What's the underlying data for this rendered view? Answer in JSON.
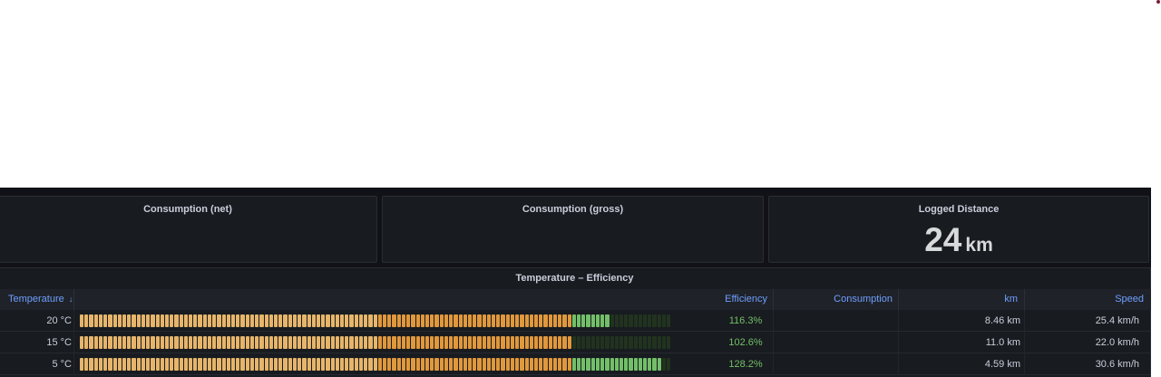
{
  "colors": {
    "panel_bg": "#181b1f",
    "header_text": "#6e9fff",
    "efficiency_text": "#73bf69",
    "bar_orange": "#e0983c",
    "bar_yellow": "#e6b56b",
    "bar_green": "#73bf69",
    "bar_green_dim": "#21331f"
  },
  "panels": {
    "net": {
      "title": "Consumption (net)"
    },
    "gross": {
      "title": "Consumption (gross)"
    },
    "distance": {
      "title": "Logged Distance",
      "value": "24",
      "unit": "km"
    }
  },
  "table": {
    "title": "Temperature – Efficiency",
    "sort_icon": "arrow-down-icon",
    "columns": {
      "temperature": "Temperature",
      "sort_glyph": "↓",
      "efficiency": "Efficiency",
      "consumption": "Consumption",
      "km": "km",
      "speed": "Speed"
    },
    "rows": [
      {
        "temperature": "20 °C",
        "efficiency": "116.3%",
        "efficiency_value": 116.3,
        "consumption": "",
        "km": "8.46 km",
        "speed": "25.4 km/h"
      },
      {
        "temperature": "15 °C",
        "efficiency": "102.6%",
        "efficiency_value": 102.6,
        "consumption": "",
        "km": "11.0 km",
        "speed": "22.0 km/h"
      },
      {
        "temperature": "5 °C",
        "efficiency": "128.2%",
        "efficiency_value": 128.2,
        "consumption": "",
        "km": "4.59 km",
        "speed": "30.6 km/h"
      }
    ]
  }
}
